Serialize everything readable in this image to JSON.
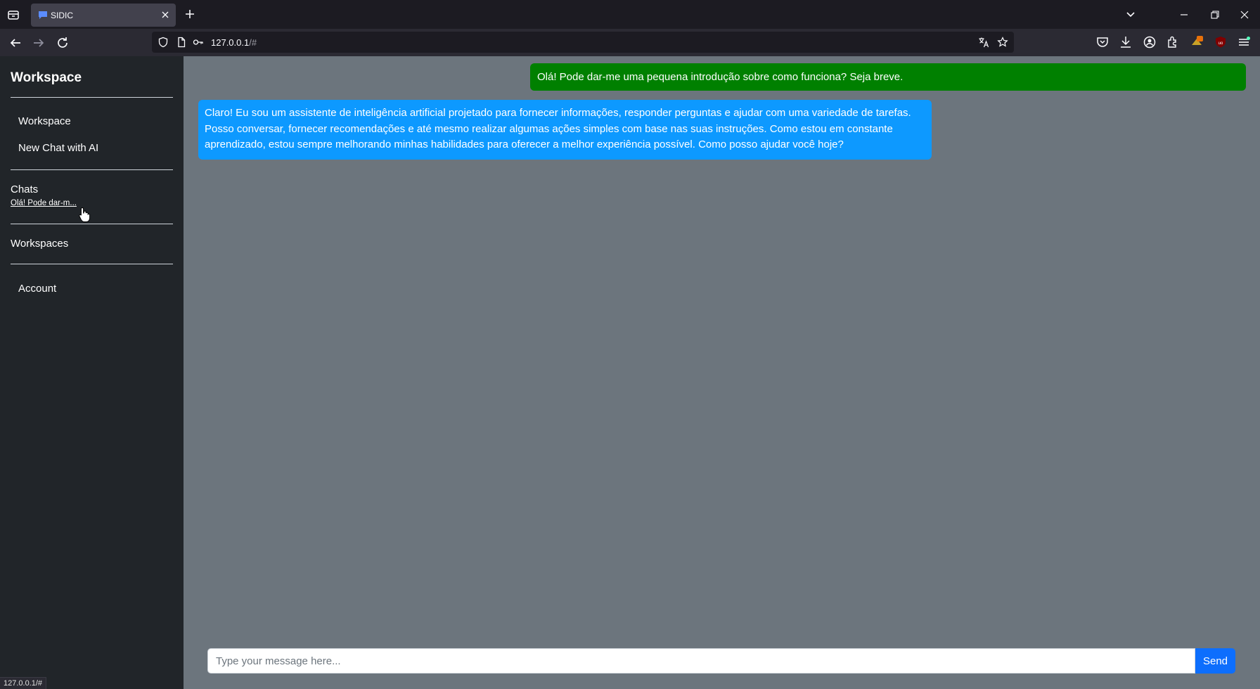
{
  "browser": {
    "tab_title": "SIDIC",
    "url_host": "127.0.0.1",
    "url_path": "/#",
    "status_url": "127.0.0.1/#"
  },
  "sidebar": {
    "title": "Workspace",
    "links": [
      "Workspace",
      "New Chat with AI"
    ],
    "chats_heading": "Chats",
    "chats": [
      "Olá! Pode dar-m..."
    ],
    "workspaces_heading": "Workspaces",
    "account_label": "Account"
  },
  "conversation": {
    "user_message": "Olá! Pode dar-me uma pequena introdução sobre como funciona? Seja breve.",
    "ai_message_lines": [
      "Claro! Eu sou um assistente de inteligência artificial projetado para fornecer informações, responder perguntas e ajudar com uma variedade de tarefas.",
      "Posso conversar, fornecer recomendações e até mesmo realizar algumas ações simples com base nas suas instruções. Como estou em constante",
      "aprendizado, estou sempre melhorando minhas habilidades para oferecer a melhor experiência possível. Como posso ajudar você hoje?"
    ]
  },
  "composer": {
    "placeholder": "Type your message here...",
    "send_label": "Send"
  },
  "colors": {
    "sidebar_bg": "#212529",
    "main_bg": "#6c757d",
    "user_bubble": "#008000",
    "ai_bubble": "#0d99ff",
    "send_button": "#0d6efd"
  }
}
